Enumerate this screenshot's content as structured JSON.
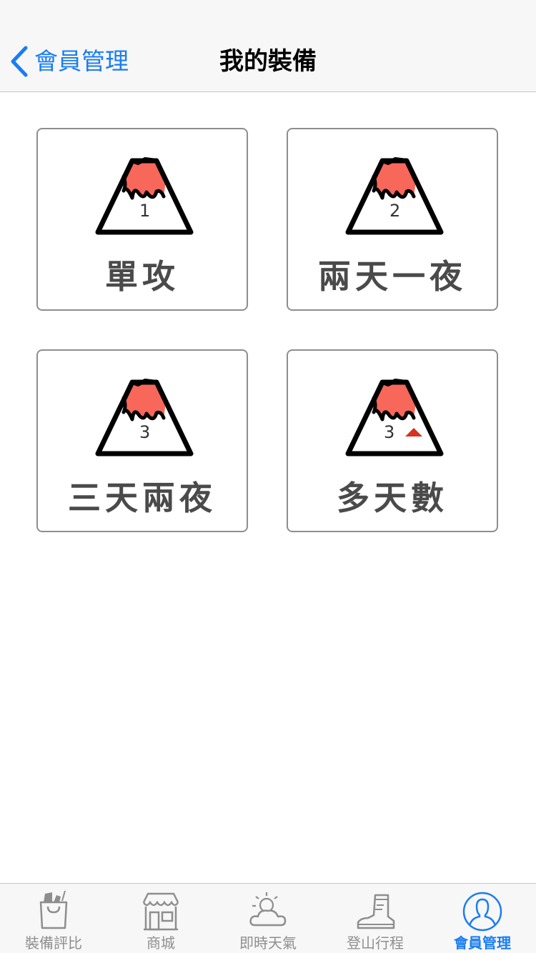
{
  "nav": {
    "back_label": "會員管理",
    "title": "我的裝備"
  },
  "cards": [
    {
      "label": "單攻",
      "number": "1",
      "extra_marker": false
    },
    {
      "label": "兩天一夜",
      "number": "2",
      "extra_marker": false
    },
    {
      "label": "三天兩夜",
      "number": "3",
      "extra_marker": false
    },
    {
      "label": "多天數",
      "number": "3",
      "extra_marker": true
    }
  ],
  "tabs": [
    {
      "label": "裝備評比",
      "icon": "shopping-bag-icon",
      "active": false
    },
    {
      "label": "商城",
      "icon": "storefront-icon",
      "active": false
    },
    {
      "label": "即時天氣",
      "icon": "weather-icon",
      "active": false
    },
    {
      "label": "登山行程",
      "icon": "hiking-boot-icon",
      "active": false
    },
    {
      "label": "會員管理",
      "icon": "user-profile-icon",
      "active": true
    }
  ],
  "colors": {
    "accent": "#1a7df2",
    "mountain_peak": "#f7675a",
    "marker_red": "#d9301f",
    "card_text": "#4a4a4a"
  }
}
